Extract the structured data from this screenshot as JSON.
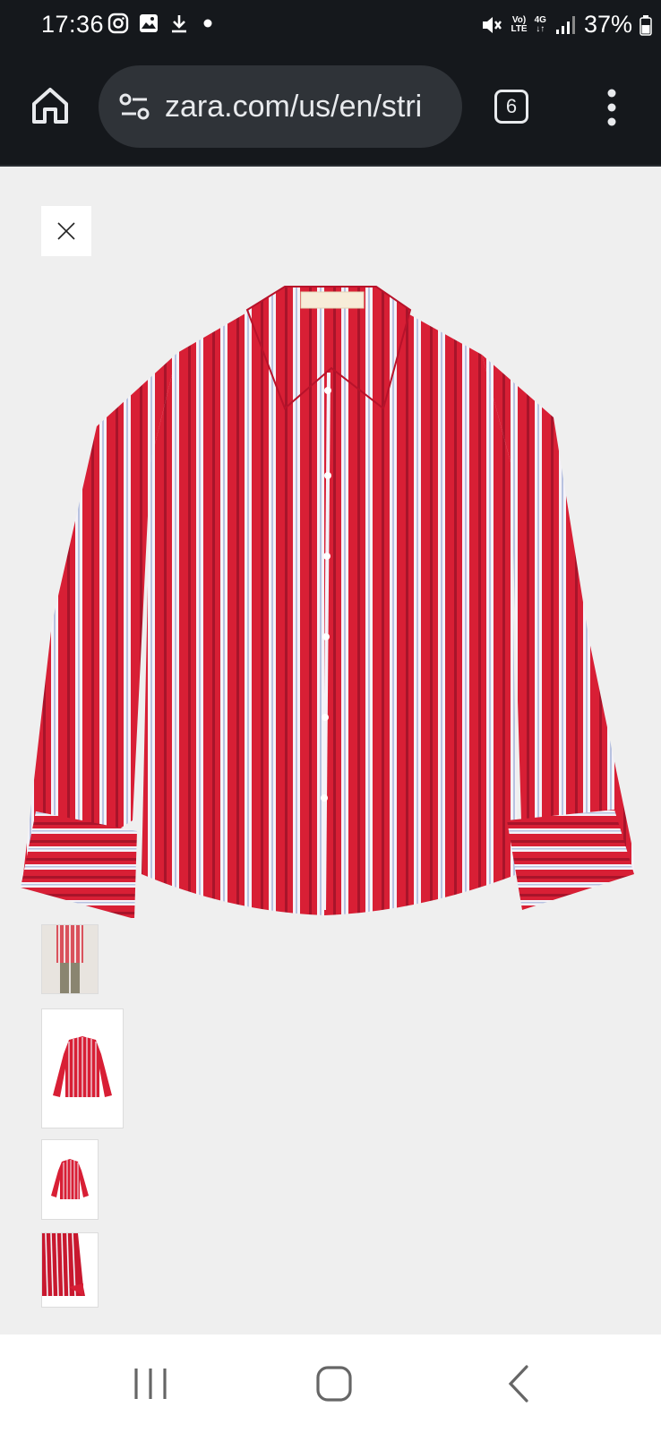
{
  "status_bar": {
    "time": "17:36",
    "left_icons": [
      "instagram-icon",
      "gallery-icon",
      "download-icon",
      "dot-icon"
    ],
    "volte_label_top": "Vo)",
    "volte_label_bottom": "LTE",
    "network_label": "4G",
    "battery_percent": "37%"
  },
  "browser": {
    "url": "zara.com/us/en/stri",
    "tab_count": "6"
  },
  "product": {
    "image_icon": "striped-shirt-image",
    "colors": {
      "stripe_red": "#d81f35",
      "stripe_white": "#f4f2f8",
      "stripe_dark": "#a8142a"
    }
  },
  "thumbnails": [
    {
      "icon": "model-back-view-thumbnail"
    },
    {
      "icon": "shirt-front-thumbnail"
    },
    {
      "icon": "shirt-small-thumbnail"
    },
    {
      "icon": "fabric-detail-thumbnail"
    }
  ],
  "nav_bar": {
    "items": [
      "recent-apps-icon",
      "home-icon",
      "back-icon"
    ]
  }
}
